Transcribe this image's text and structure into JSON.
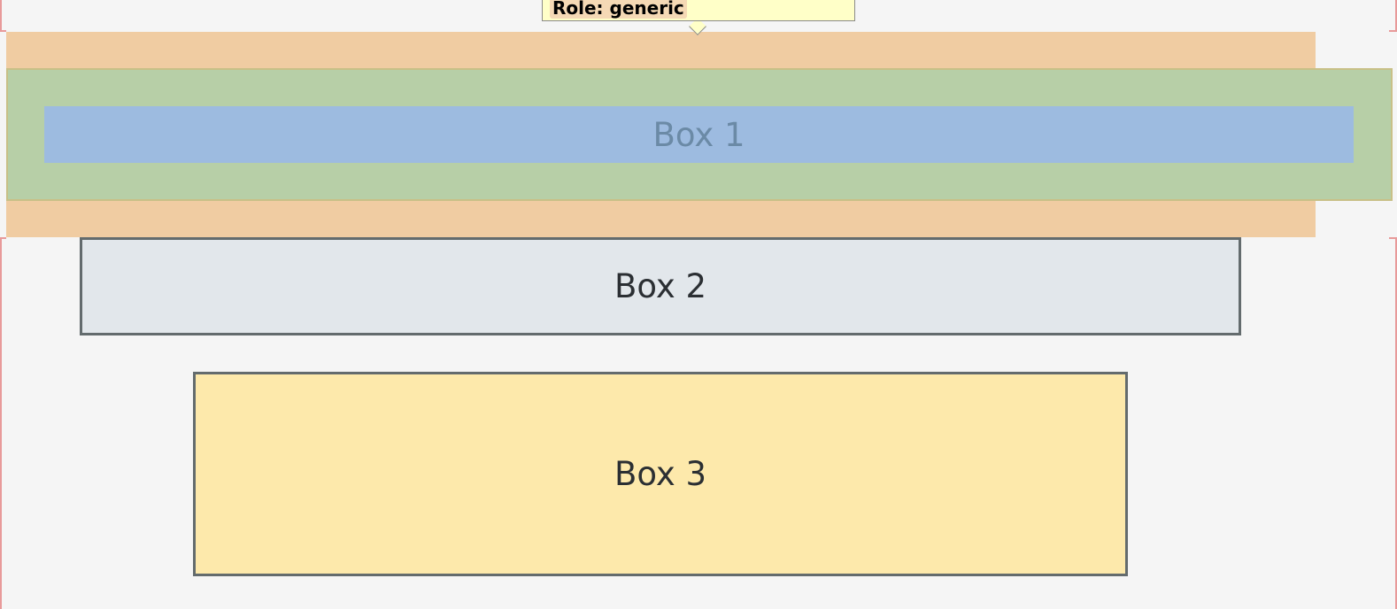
{
  "tooltip": {
    "role_text": "Role: generic"
  },
  "boxes": [
    {
      "label": "Box 1"
    },
    {
      "label": "Box 2"
    },
    {
      "label": "Box 3"
    }
  ],
  "colors": {
    "page_background": "#f5f5f5",
    "margin_highlight": "#f0cca2",
    "border_highlight": "#b7cfa7",
    "content_highlight": "#9dbbe0",
    "box2_background": "#e2e7eb",
    "box3_background": "#fde9ab",
    "box_border": "#636b6d",
    "tooltip_background": "#ffffc8"
  }
}
